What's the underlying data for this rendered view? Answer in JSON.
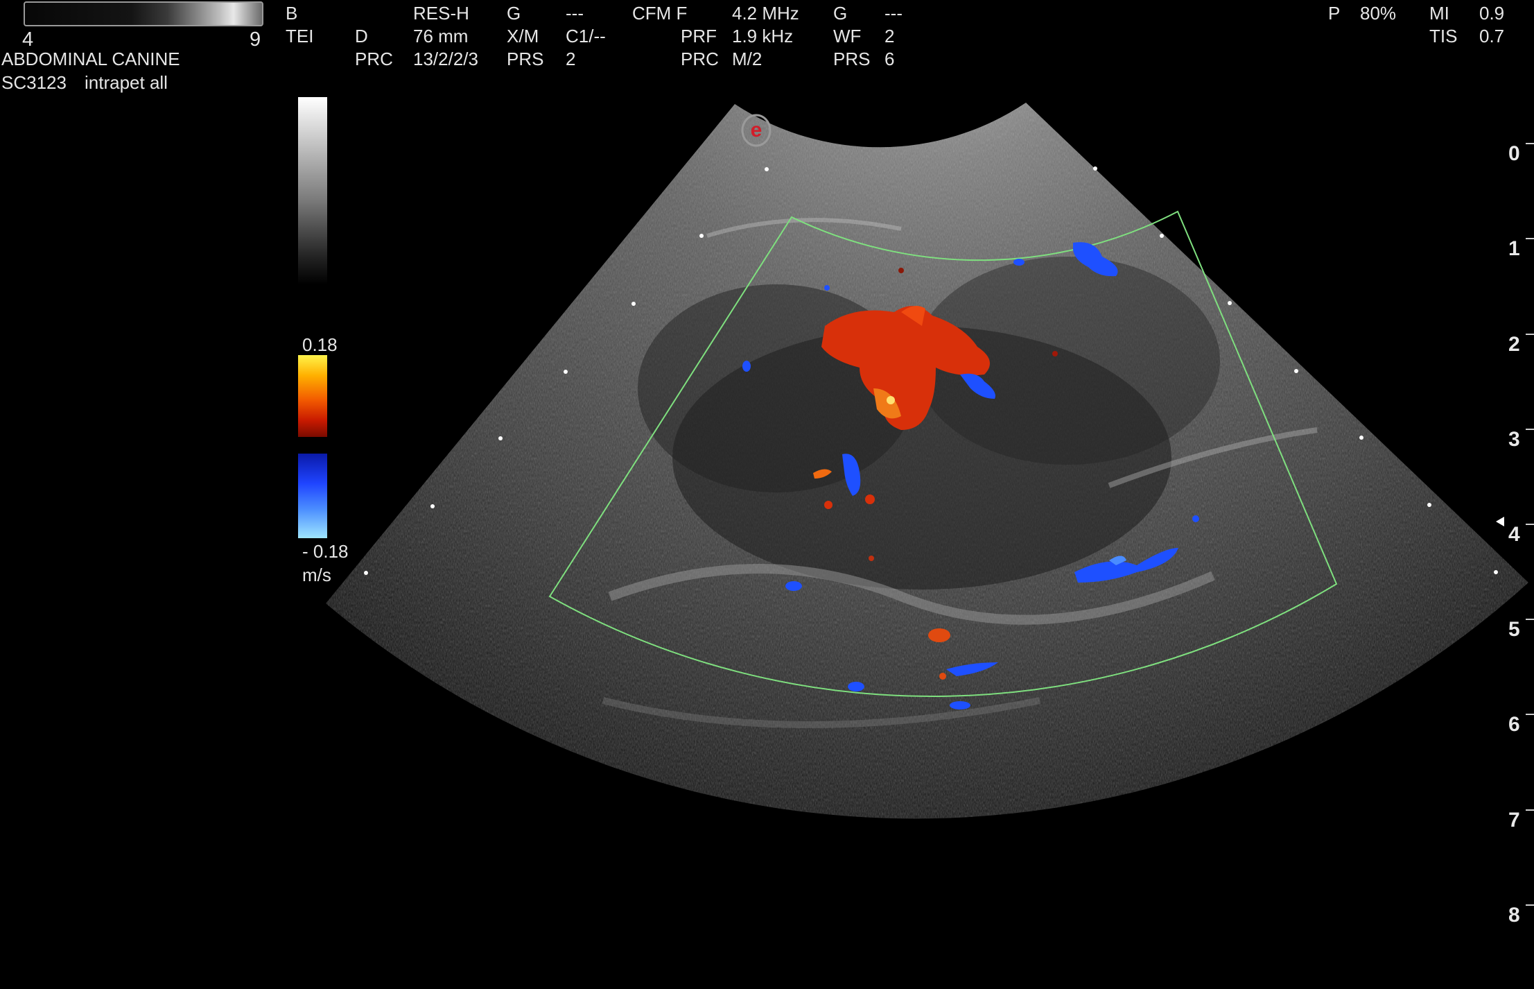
{
  "gain_bar": {
    "min": "4",
    "max": "9"
  },
  "preset": {
    "exam": "ABDOMINAL CANINE",
    "probe": "SC3123",
    "preset_name": "intrapet all"
  },
  "bmode": {
    "mode": "B",
    "tei": "TEI",
    "res": "RES-H",
    "d_label": "D",
    "depth": "76 mm",
    "prc_label": "PRC",
    "prc": "13/2/2/3",
    "g_label": "G",
    "g_value": "---",
    "xm_label": "X/M",
    "xm_value": "C1/--",
    "prs_label": "PRS",
    "prs_value": "2"
  },
  "cfm": {
    "mode": "CFM F",
    "freq": "4.2 MHz",
    "prf_label": "PRF",
    "prf": "1.9 kHz",
    "prc_label": "PRC",
    "prc": "M/2",
    "g_label": "G",
    "g_value": "---",
    "wf_label": "WF",
    "wf_value": "2",
    "prs_label": "PRS",
    "prs_value": "6"
  },
  "power": {
    "p_label": "P",
    "p_value": "80%",
    "mi_label": "MI",
    "mi_value": "0.9",
    "tis_label": "TIS",
    "tis_value": "0.7"
  },
  "color_scale": {
    "max": "0.18",
    "min": "- 0.18",
    "unit": "m/s",
    "logo": "e"
  },
  "depth_ruler": [
    "0",
    "1",
    "2",
    "3",
    "4",
    "5",
    "6",
    "7",
    "8"
  ],
  "colors": {
    "roi_box": "#7fe07f",
    "doppler_red": "#e0380a",
    "doppler_blue": "#1e50ff"
  }
}
